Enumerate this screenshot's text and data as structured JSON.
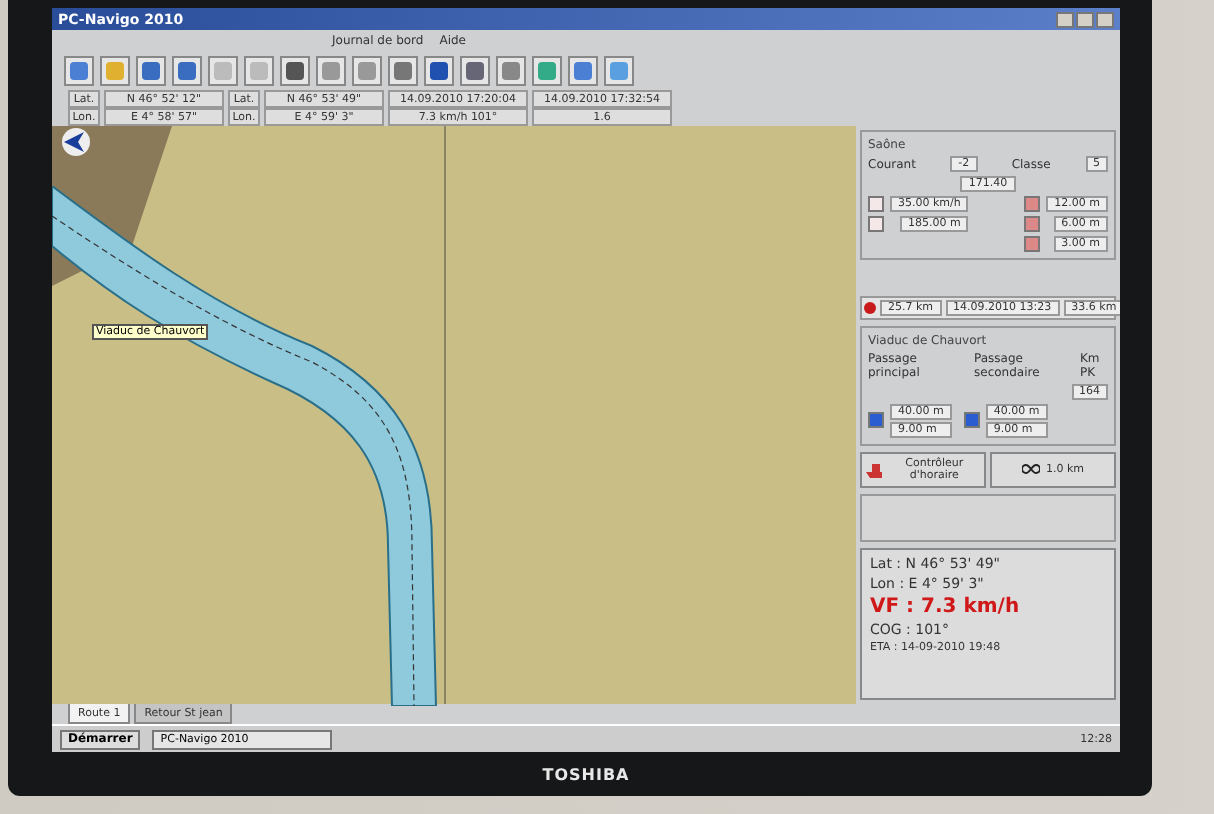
{
  "window": {
    "title": "PC-Navigo 2010"
  },
  "menu": [
    "Journal de bord",
    "Aide"
  ],
  "coords": [
    {
      "label_a": "Lat.",
      "value_a": "N 46° 52' 12\"",
      "label_b": "Lat.",
      "value_b": "N 46° 53' 49\"",
      "value_c": "14.09.2010 17:20:04",
      "value_d": "14.09.2010 17:32:54"
    },
    {
      "label_a": "Lon.",
      "value_a": "E 4° 58' 57\"",
      "label_b": "Lon.",
      "value_b": "E 4° 59' 3\"",
      "value_c": "7.3 km/h 101°",
      "value_d": "1.6"
    }
  ],
  "map": {
    "label": "Viaduc de Chauvort"
  },
  "river": {
    "title": "Saône",
    "current_label": "Courant",
    "current": "-2",
    "class_label": "Classe",
    "class": "5",
    "pk": "171.40",
    "left": [
      "35.00 km/h",
      "185.00 m"
    ],
    "right": [
      "12.00 m",
      "6.00 m",
      "3.00 m"
    ]
  },
  "distance": {
    "before": "25.7 km",
    "after": "33.6 km",
    "time": "14.09.2010 13:23"
  },
  "bridge": {
    "title": "Viaduc de Chauvort",
    "main_label": "Passage principal",
    "second_label": "Passage secondaire",
    "km_label": "Km PK",
    "km": "164",
    "main": [
      "40.00 m",
      "9.00 m"
    ],
    "second": [
      "40.00 m",
      "9.00 m"
    ]
  },
  "buttons": [
    {
      "kind": "schedule",
      "label": "Contrôleur d'horaire"
    },
    {
      "kind": "range",
      "label": "1.0 km"
    }
  ],
  "info": {
    "lat": "Lat : N 46° 53' 49\"",
    "lon": "Lon : E 4° 59' 3\"",
    "speed": "VF : 7.3 km/h",
    "cog": "COG : 101°",
    "eta": "ETA :  14-09-2010 19:48"
  },
  "tabs": [
    {
      "label": "Route 1",
      "selected": true
    },
    {
      "label": "Retour St jean",
      "selected": false
    }
  ],
  "taskbar": {
    "start": "Démarrer",
    "task": "PC-Navigo 2010",
    "clock": "12:28"
  },
  "brand": "TOSHIBA"
}
